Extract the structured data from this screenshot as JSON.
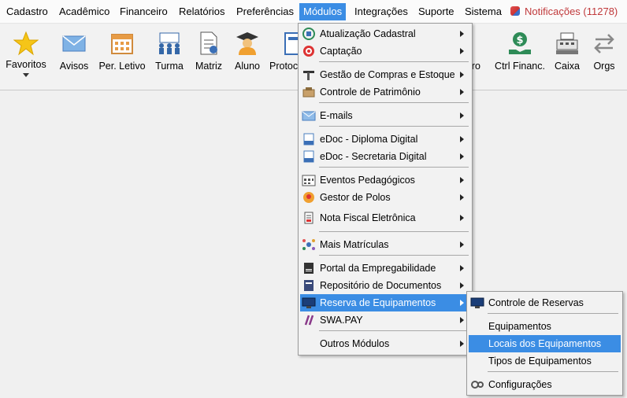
{
  "menubar": {
    "items": [
      {
        "label": "Cadastro"
      },
      {
        "label": "Acadêmico"
      },
      {
        "label": "Financeiro"
      },
      {
        "label": "Relatórios"
      },
      {
        "label": "Preferências"
      },
      {
        "label": "Módulos"
      },
      {
        "label": "Integrações"
      },
      {
        "label": "Suporte"
      },
      {
        "label": "Sistema"
      }
    ],
    "notifications": "Notificações (11278)"
  },
  "toolbar": {
    "items": [
      {
        "label": "Favoritos",
        "icon": "star-icon"
      },
      {
        "label": "Avisos",
        "icon": "envelope-icon"
      },
      {
        "label": "Per. Letivo",
        "icon": "calendar-icon"
      },
      {
        "label": "Turma",
        "icon": "class-icon"
      },
      {
        "label": "Matriz",
        "icon": "document-icon"
      },
      {
        "label": "Aluno",
        "icon": "student-icon"
      },
      {
        "label": "Protoc",
        "icon": "protocol-icon"
      },
      {
        "label": "iro",
        "icon": "hidden-icon"
      },
      {
        "label": "Ctrl Financ.",
        "icon": "money-hand-icon"
      },
      {
        "label": "Caixa",
        "icon": "cash-register-icon"
      },
      {
        "label": "Orgs",
        "icon": "arrows-icon"
      }
    ]
  },
  "modulos_menu": {
    "groups": [
      [
        {
          "label": "Atualização Cadastral",
          "icon": "refresh-icon"
        },
        {
          "label": "Captação",
          "icon": "target-icon"
        }
      ],
      [
        {
          "label": "Gestão de Compras e Estoque",
          "icon": "tools-icon"
        },
        {
          "label": "Controle de Patrimônio",
          "icon": "box-icon"
        }
      ],
      [
        {
          "label": "E-mails",
          "icon": "mail-icon"
        }
      ],
      [
        {
          "label": "eDoc - Diploma Digital",
          "icon": "edoc-icon"
        },
        {
          "label": "eDoc - Secretaria Digital",
          "icon": "edoc-icon"
        }
      ],
      [
        {
          "label": "Eventos Pedagógicos",
          "icon": "events-icon"
        },
        {
          "label": "Gestor de Polos",
          "icon": "poles-icon"
        },
        {
          "label": "Nota Fiscal Eletrônica",
          "icon": "invoice-icon"
        }
      ],
      [
        {
          "label": "Mais Matrículas",
          "icon": "network-icon"
        }
      ],
      [
        {
          "label": "Portal da Empregabilidade",
          "icon": "cv-icon"
        },
        {
          "label": "Repositório de Documentos",
          "icon": "repository-icon"
        },
        {
          "label": "Reserva de Equipamentos",
          "icon": "monitor-icon"
        },
        {
          "label": "SWA.PAY",
          "icon": "swapay-icon"
        }
      ],
      [
        {
          "label": "Outros Módulos",
          "icon": ""
        }
      ]
    ]
  },
  "reserva_submenu": {
    "items": [
      {
        "label": "Controle de Reservas",
        "icon": "monitor-icon"
      },
      {
        "label": "Equipamentos",
        "icon": ""
      },
      {
        "label": "Locais dos Equipamentos",
        "icon": ""
      },
      {
        "label": "Tipos de Equipamentos",
        "icon": ""
      },
      {
        "label": "Configurações",
        "icon": "gears-icon"
      }
    ]
  },
  "colors": {
    "highlight": "#3b8de4",
    "notification": "#c0393b"
  }
}
